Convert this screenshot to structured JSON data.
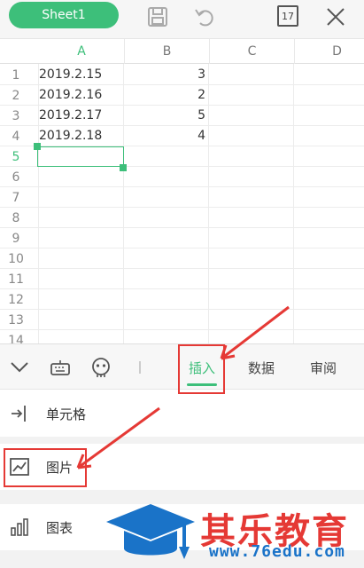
{
  "topbar": {
    "sheet_name": "Sheet1",
    "count_badge": "17",
    "icons": [
      "save-icon",
      "undo-icon",
      "count-icon",
      "close-icon"
    ]
  },
  "grid": {
    "columns": [
      "A",
      "B",
      "C",
      "D"
    ],
    "active_column": "A",
    "rows": [
      {
        "num": "1",
        "a": "2019.2.15",
        "b": "3"
      },
      {
        "num": "2",
        "a": "2019.2.16",
        "b": "2"
      },
      {
        "num": "3",
        "a": "2019.2.17",
        "b": "5"
      },
      {
        "num": "4",
        "a": "2019.2.18",
        "b": "4"
      },
      {
        "num": "5",
        "a": "",
        "b": ""
      },
      {
        "num": "6",
        "a": "",
        "b": ""
      },
      {
        "num": "7",
        "a": "",
        "b": ""
      },
      {
        "num": "8",
        "a": "",
        "b": ""
      },
      {
        "num": "9",
        "a": "",
        "b": ""
      },
      {
        "num": "10",
        "a": "",
        "b": ""
      },
      {
        "num": "11",
        "a": "",
        "b": ""
      },
      {
        "num": "12",
        "a": "",
        "b": ""
      },
      {
        "num": "13",
        "a": "",
        "b": ""
      },
      {
        "num": "14",
        "a": "",
        "b": ""
      }
    ],
    "active_row": "5",
    "accent": "#3dbf7a"
  },
  "toolbar": {
    "tabs": [
      {
        "label": "插入",
        "active": true
      },
      {
        "label": "数据",
        "active": false
      },
      {
        "label": "审阅",
        "active": false
      }
    ],
    "icons": [
      "chevron-down-icon",
      "keyboard-icon",
      "emoji-icon"
    ]
  },
  "menu": {
    "items": [
      {
        "label": "单元格",
        "icon": "insert-cell-icon"
      },
      {
        "label": "图片",
        "icon": "picture-icon"
      },
      {
        "label": "图表",
        "icon": "bar-chart-icon"
      }
    ]
  },
  "watermark": {
    "title": "其乐教育",
    "url": "www.76edu.com"
  },
  "highlight_color": "#e53935"
}
